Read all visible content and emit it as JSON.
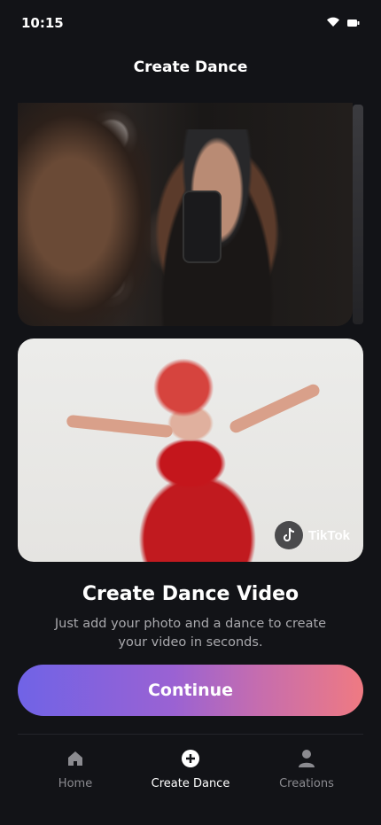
{
  "status_bar": {
    "time": "10:15",
    "icons": [
      "wifi-icon",
      "battery-icon"
    ]
  },
  "header": {
    "title": "Create Dance"
  },
  "cards": {
    "bottom_badge": {
      "icon": "tiktok-icon",
      "label": "TikTok"
    }
  },
  "content": {
    "title": "Create Dance Video",
    "subtitle": "Just add your photo and a dance to create your video in seconds."
  },
  "actions": {
    "continue_label": "Continue"
  },
  "tab_bar": {
    "items": [
      {
        "label": "Home",
        "icon": "home-icon",
        "active": false
      },
      {
        "label": "Create Dance",
        "icon": "plus-circle-icon",
        "active": true
      },
      {
        "label": "Creations",
        "icon": "person-icon",
        "active": false
      }
    ]
  },
  "colors": {
    "background": "#121317",
    "button_gradient_start": "#7063e6",
    "button_gradient_end": "#ef7a82",
    "inactive_tab": "#8b8b90",
    "active_tab": "#ffffff"
  }
}
